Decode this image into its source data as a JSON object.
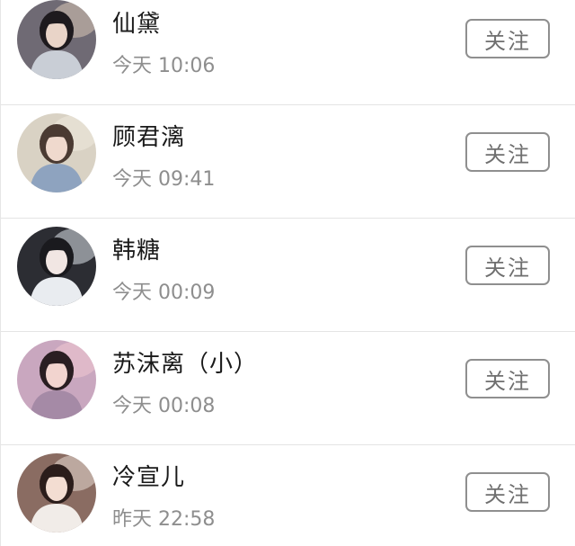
{
  "follow_list": {
    "items": [
      {
        "name": "仙黛",
        "time": "今天 10:06",
        "button": "关注",
        "avatar": {
          "bg": "#6f6a74",
          "accent": "#d8c7b6",
          "hair": "#1e1a1e",
          "skin": "#e9d4c8",
          "cloth": "#c9ced6"
        }
      },
      {
        "name": "顾君漓",
        "time": "今天 09:41",
        "button": "关注",
        "avatar": {
          "bg": "#d9d2c4",
          "accent": "#efe9df",
          "hair": "#4a3a32",
          "skin": "#efd9cd",
          "cloth": "#8ea3bf"
        }
      },
      {
        "name": "韩糖",
        "time": "今天 00:09",
        "button": "关注",
        "avatar": {
          "bg": "#2c2d33",
          "accent": "#dfe3ea",
          "hair": "#1a1a1e",
          "skin": "#f1e6e3",
          "cloth": "#e9ecf0"
        }
      },
      {
        "name": "苏沫离（小）",
        "time": "今天 00:08",
        "button": "关注",
        "avatar": {
          "bg": "#c9a7bf",
          "accent": "#f0c9d2",
          "hair": "#2a1e22",
          "skin": "#f2d4cf",
          "cloth": "#a58aa6"
        }
      },
      {
        "name": "冷宣儿",
        "time": "昨天 22:58",
        "button": "关注",
        "avatar": {
          "bg": "#8a6c62",
          "accent": "#e6dad2",
          "hair": "#2b1d1b",
          "skin": "#f3ddd2",
          "cloth": "#f1ece8"
        }
      }
    ]
  }
}
